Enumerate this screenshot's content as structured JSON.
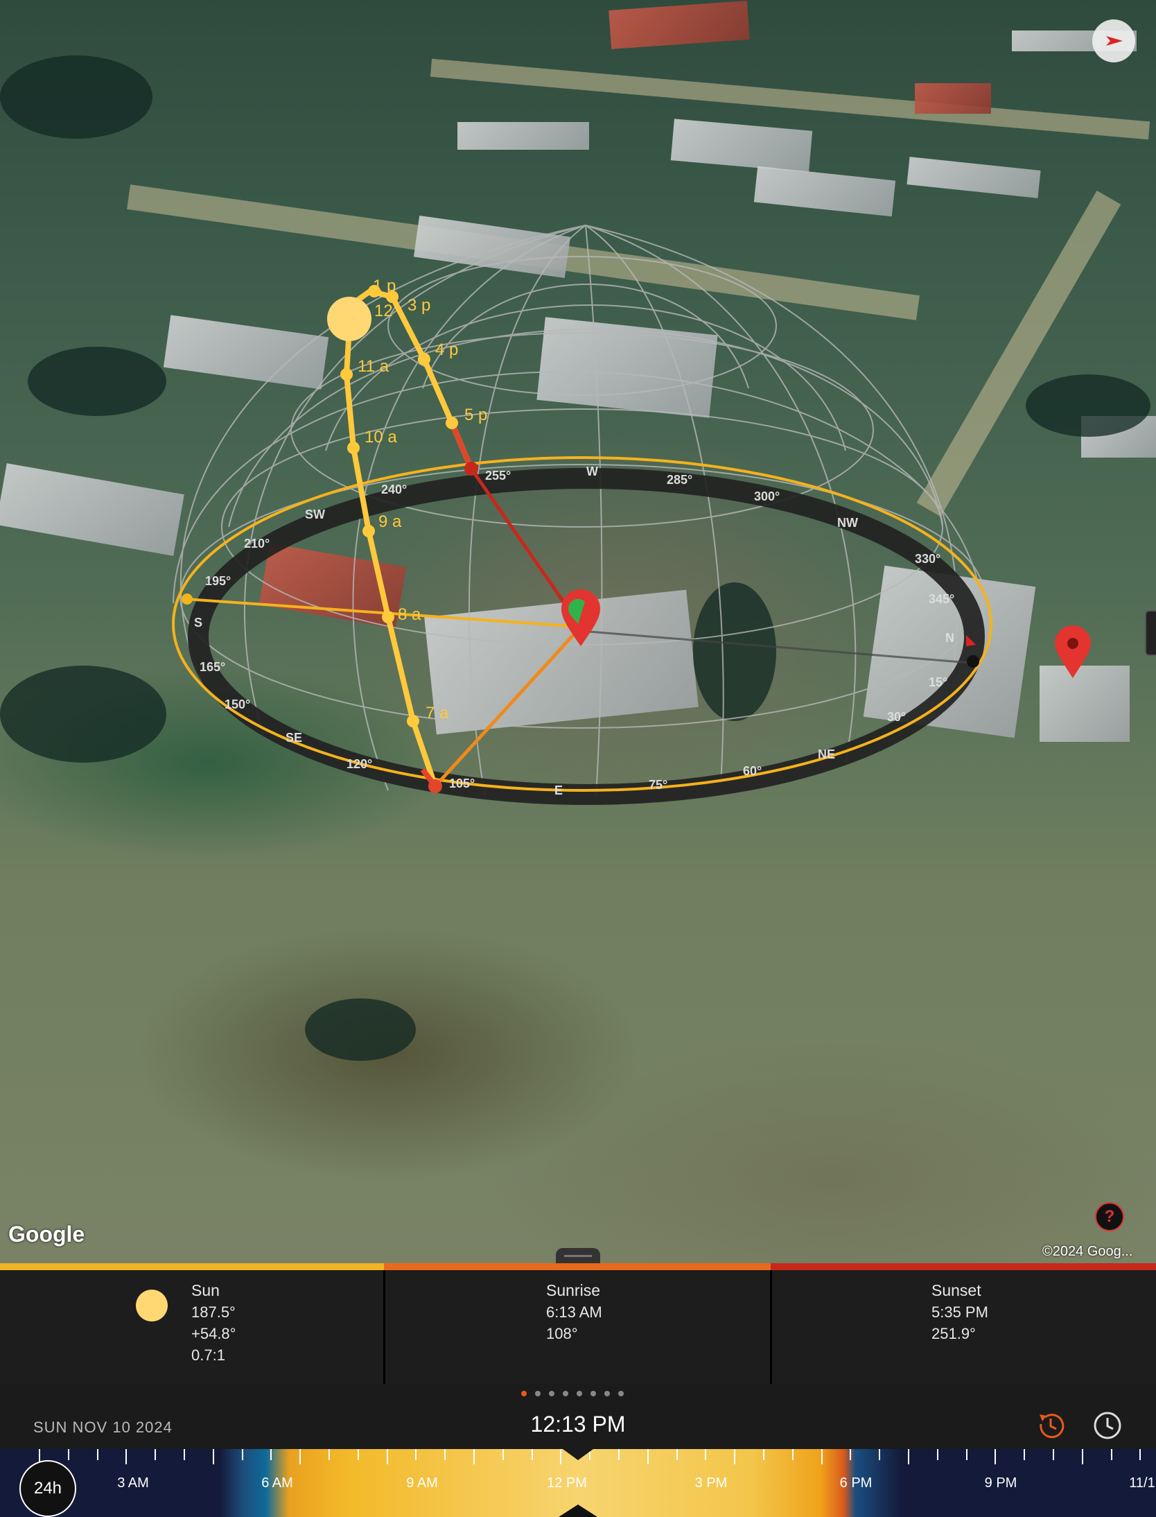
{
  "map": {
    "attribution_logo": "Google",
    "copyright": "©2024 Goog...",
    "help_label": "?",
    "hour_labels": [
      "1 p",
      "12",
      "3 p",
      "4 p",
      "11 a",
      "5 p",
      "10 a",
      "9 a",
      "8 a",
      "7 a"
    ],
    "compass_labels": [
      "255°",
      "W",
      "285°",
      "300°",
      "NW",
      "330°",
      "345°",
      "N",
      "15°",
      "30°",
      "NE",
      "60°",
      "75°",
      "E",
      "105°",
      "120°",
      "SE",
      "150°",
      "165°",
      "S",
      "195°",
      "210°",
      "SW",
      "240°"
    ],
    "colors": {
      "sun_path": "#ffc93c",
      "sunrise_line": "#f08a1c",
      "sunset_line": "#c7281c",
      "pin": "#e3342f"
    }
  },
  "info_panel": {
    "sun": {
      "title": "Sun",
      "azimuth": "187.5°",
      "elevation": "+54.8°",
      "ratio": "0.7:1"
    },
    "sunrise": {
      "title": "Sunrise",
      "time": "6:13 AM",
      "azimuth": "108°"
    },
    "sunset": {
      "title": "Sunset",
      "time": "5:35 PM",
      "azimuth": "251.9°"
    },
    "strip_colors": [
      "#f0b323",
      "#ea6a1d",
      "#c7281c"
    ]
  },
  "pager": {
    "count": 8,
    "active_index": 0
  },
  "datebar": {
    "date": "SUN NOV 10 2024",
    "time": "12:13 PM"
  },
  "timeline": {
    "mode_button": "24h",
    "labels": [
      "3 AM",
      "6 AM",
      "9 AM",
      "12 PM",
      "3 PM",
      "6 PM",
      "9 PM",
      "11/1"
    ]
  }
}
